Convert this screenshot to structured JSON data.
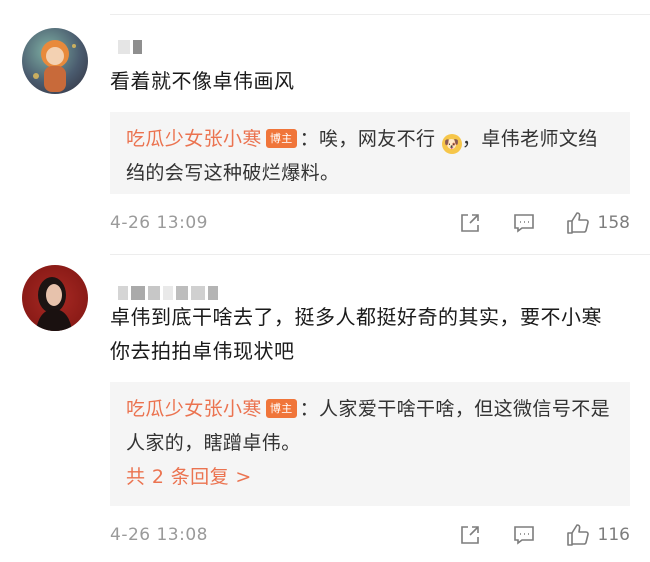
{
  "comments": [
    {
      "text": "看着就不像卓伟画风",
      "reply": {
        "author": "吃瓜少女张小寒",
        "badge": "博主",
        "text_part1": "：唉，网友不行",
        "text_part2": "，卓伟老师文绉绉的会写这种破烂爆料。",
        "emoji": "doge"
      },
      "time": "4-26 13:09",
      "likes": "158"
    },
    {
      "text": "卓伟到底干啥去了，挺多人都挺好奇的其实，要不小寒你去拍拍卓伟现状吧",
      "reply": {
        "author": "吃瓜少女张小寒",
        "badge": "博主",
        "text": "：人家爱干啥干啥，但这微信号不是人家的，瞎蹭卓伟。",
        "more": "共 2 条回复 >"
      },
      "time": "4-26 13:08",
      "likes": "116"
    }
  ]
}
